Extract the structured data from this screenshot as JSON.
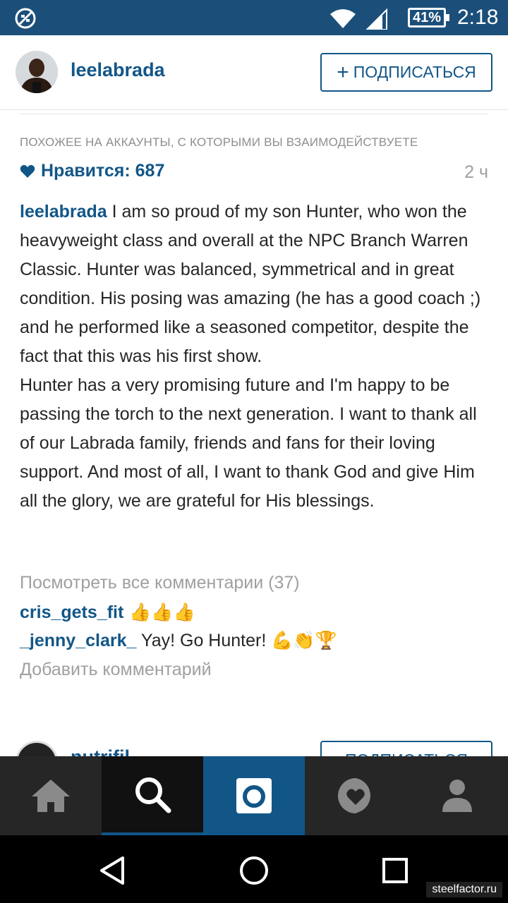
{
  "status_bar": {
    "battery": "41%",
    "time": "2:18"
  },
  "header": {
    "username": "leelabrada",
    "follow_label": "ПОДПИСАТЬСЯ"
  },
  "post": {
    "suggestion_text": "ПОХОЖЕЕ НА АККАУНТЫ, С КОТОРЫМИ ВЫ ВЗАИМОДЕЙСТВУЕТЕ",
    "likes_text": "Нравится: 687",
    "time_ago": "2 ч",
    "caption_user": "leelabrada",
    "caption_text": " I am so proud of my son Hunter, who won the heavyweight class and overall at the NPC Branch Warren Classic. Hunter was balanced, symmetrical and in great condition. His posing was amazing (he has a good coach ;) and he performed like a seasoned competitor, despite the fact that this was his first show.",
    "caption_text_2": "Hunter has a very promising future and I'm happy to be passing the torch to the next generation. I want to thank all of our Labrada family, friends and fans for their loving support. And most of all, I want to thank God and give Him all the glory, we are grateful for His blessings.",
    "view_all_comments": "Посмотреть все комментарии (37)",
    "comments": [
      {
        "user": "cris_gets_fit",
        "text": " 👍👍👍"
      },
      {
        "user": "_jenny_clark_",
        "text": " Yay! Go Hunter! 💪👏🏆"
      }
    ],
    "add_comment": "Добавить комментарий"
  },
  "next_post": {
    "username": "nutrifil..."
  },
  "tabs": [
    {
      "name": "home-icon"
    },
    {
      "name": "search-icon"
    },
    {
      "name": "camera-icon"
    },
    {
      "name": "activity-icon"
    },
    {
      "name": "profile-icon"
    }
  ],
  "watermark": "steelfactor.ru",
  "colors": {
    "status_bar": "#1b4f7a",
    "link_blue": "#125688",
    "tab_bar": "#262626"
  }
}
